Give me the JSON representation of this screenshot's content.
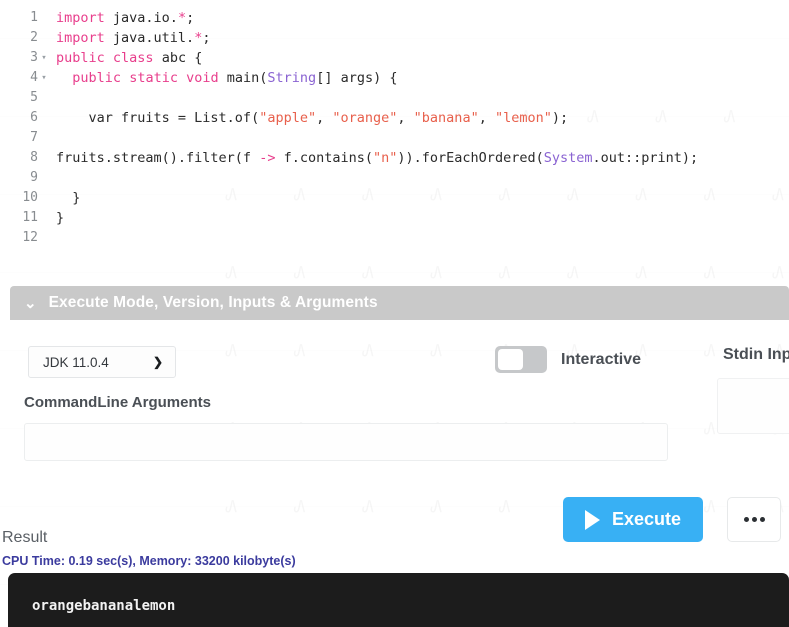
{
  "editor": {
    "name": "java-code-editor",
    "lines": [
      {
        "num": "1",
        "fold": "",
        "html": "<span class=\"tk-kw\">import</span> java.io.<span class=\"tk-kw\">*</span>;"
      },
      {
        "num": "2",
        "fold": "",
        "html": "<span class=\"tk-kw\">import</span> java.util.<span class=\"tk-kw\">*</span>;"
      },
      {
        "num": "3",
        "fold": "▾",
        "html": "<span class=\"tk-kw\">public</span> <span class=\"tk-kw\">class</span> abc {"
      },
      {
        "num": "4",
        "fold": "▾",
        "html": "  <span class=\"tk-kw\">public</span> <span class=\"tk-kw\">static</span> <span class=\"tk-kw\">void</span> main(<span class=\"tk-type\">String</span>[] args) {"
      },
      {
        "num": "5",
        "fold": "",
        "html": ""
      },
      {
        "num": "6",
        "fold": "",
        "html": "    var fruits = List.of(<span class=\"tk-str\">\"apple\"</span>, <span class=\"tk-str\">\"orange\"</span>, <span class=\"tk-str\">\"banana\"</span>, <span class=\"tk-str\">\"lemon\"</span>);"
      },
      {
        "num": "7",
        "fold": "",
        "html": ""
      },
      {
        "num": "8",
        "fold": "",
        "html": "fruits.stream().filter(f <span class=\"tk-op\">-&gt;</span> f.contains(<span class=\"tk-str\">\"n\"</span>)).forEachOrdered(<span class=\"tk-type\">System</span>.out::print);"
      },
      {
        "num": "9",
        "fold": "",
        "html": ""
      },
      {
        "num": "10",
        "fold": "",
        "html": "  }"
      },
      {
        "num": "11",
        "fold": "",
        "html": "}"
      },
      {
        "num": "12",
        "fold": "",
        "html": ""
      }
    ],
    "plain_code": "import java.io.*;\nimport java.util.*;\npublic class abc {\n  public static void main(String[] args) {\n\n    var fruits = List.of(\"apple\", \"orange\", \"banana\", \"lemon\");\n\nfruits.stream().filter(f -> f.contains(\"n\")).forEachOrdered(System.out::print);\n\n  }\n}\n"
  },
  "settings_panel": {
    "header_title": "Execute Mode, Version, Inputs & Arguments",
    "collapse_icon": "chevron-down-icon",
    "version_select": {
      "value": "JDK 11.0.4",
      "caret_icon": "chevron-down-icon"
    },
    "interactive_toggle": {
      "label": "Interactive",
      "state": "off"
    },
    "stdin": {
      "label": "Stdin Inp",
      "value": "",
      "placeholder": ""
    },
    "commandline": {
      "label": "CommandLine Arguments",
      "value": "",
      "placeholder": ""
    },
    "execute_button": {
      "label": "Execute",
      "icon": "play-icon"
    },
    "more_button": {
      "label": "•••",
      "icon": "ellipsis-icon"
    }
  },
  "result": {
    "title": "Result",
    "stats": "CPU Time: 0.19 sec(s), Memory: 33200 kilobyte(s)",
    "console_output": "orangebananalemon"
  },
  "colors": {
    "accent_blue": "#38b0f4",
    "panel_header_gray": "#c9c9c9",
    "stats_blue": "#3b3b9e",
    "console_bg": "#1c1c1c",
    "keyword_pink": "#e83e8c",
    "string_red": "#e8604c",
    "type_purple": "#8a63d2"
  }
}
